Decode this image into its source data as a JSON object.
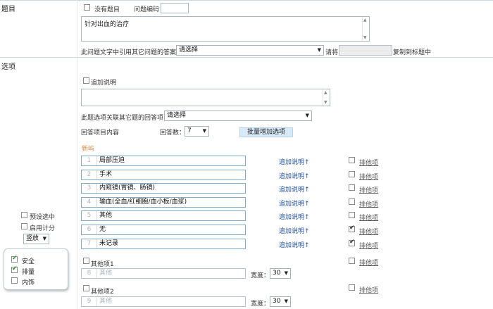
{
  "title_section": {
    "label": "题目",
    "no_title_label": "没有题目",
    "question_code_label": "问题编码",
    "question_code_value": "",
    "question_text": "针对出血的治疗",
    "reference_label": "此问题文字中引用其它问题的答案",
    "reference_select": "请选择",
    "please_label": "请将",
    "copy_to_title_label": "复制到标题中"
  },
  "options_section": {
    "label": "选项",
    "add_note_label": "追加说明",
    "related_label": "此题选项关联其它题的回答项",
    "related_select": "请选择",
    "answer_content_label": "回答项目内容",
    "answer_count_label": "回答数：",
    "answer_count_value": "7",
    "batch_add_button": "批量增加选项",
    "new_label": "新屿",
    "add_note_link": "追加说明↑",
    "exclusive_label": "排他项",
    "items": [
      {
        "index": "1",
        "text": "局部压迫",
        "exclusive": false
      },
      {
        "index": "2",
        "text": "手术",
        "exclusive": false
      },
      {
        "index": "3",
        "text": "内窥镜(胃镜、肠镜)",
        "exclusive": false
      },
      {
        "index": "4",
        "text": "输血(全血/红细胞/血小板/血浆)",
        "exclusive": false
      },
      {
        "index": "5",
        "text": "其他",
        "exclusive": false
      },
      {
        "index": "6",
        "text": "无",
        "exclusive": true
      },
      {
        "index": "7",
        "text": "未记录",
        "exclusive": true
      }
    ],
    "other_items": [
      {
        "label": "其他项1",
        "index": "8",
        "placeholder": "其他",
        "width_label": "宽度：",
        "width_value": "30"
      },
      {
        "label": "其他项2",
        "index": "9",
        "placeholder": "其他",
        "width_label": "宽度：",
        "width_value": "30"
      }
    ]
  },
  "left_panel": {
    "preset_selected_label": "预设选中",
    "enable_score_label": "启用计分",
    "layout_select": "竖放",
    "float_items": [
      {
        "label": "安全",
        "checked": true
      },
      {
        "label": "排量",
        "checked": true
      },
      {
        "label": "内饰",
        "checked": false
      }
    ]
  }
}
